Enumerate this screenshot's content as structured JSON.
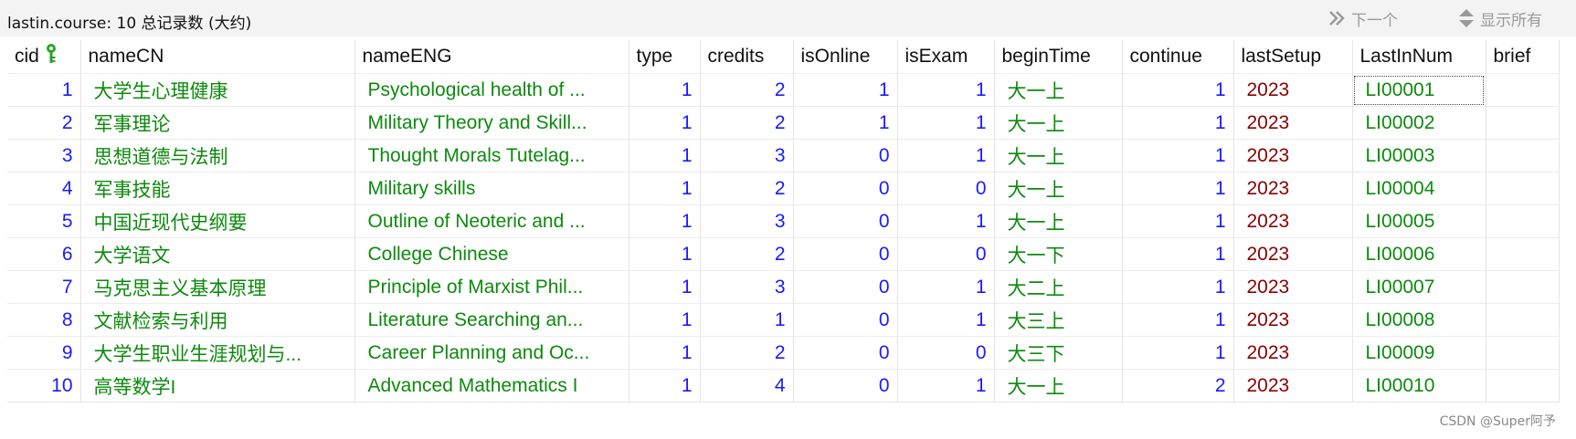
{
  "toolbar": {
    "record_label": "lastin.course: 10 总记录数 (大约)",
    "next_label": "下一个",
    "show_all_label": "显示所有"
  },
  "table": {
    "columns": [
      "cid",
      "nameCN",
      "nameENG",
      "type",
      "credits",
      "isOnline",
      "isExam",
      "beginTime",
      "continue",
      "lastSetup",
      "LastInNum",
      "brief"
    ],
    "rows": [
      [
        "1",
        "大学生心理健康",
        "Psychological health of ...",
        "1",
        "2",
        "1",
        "1",
        "大一上",
        "1",
        "2023",
        "LI00001",
        ""
      ],
      [
        "2",
        "军事理论",
        "Military Theory and Skill...",
        "1",
        "2",
        "1",
        "1",
        "大一上",
        "1",
        "2023",
        "LI00002",
        ""
      ],
      [
        "3",
        "思想道德与法制",
        "Thought Morals Tutelag...",
        "1",
        "3",
        "0",
        "1",
        "大一上",
        "1",
        "2023",
        "LI00003",
        ""
      ],
      [
        "4",
        "军事技能",
        "Military skills",
        "1",
        "2",
        "0",
        "0",
        "大一上",
        "1",
        "2023",
        "LI00004",
        ""
      ],
      [
        "5",
        "中国近现代史纲要",
        "Outline of Neoteric and ...",
        "1",
        "3",
        "0",
        "1",
        "大一上",
        "1",
        "2023",
        "LI00005",
        ""
      ],
      [
        "6",
        "大学语文",
        "College Chinese",
        "1",
        "2",
        "0",
        "0",
        "大一下",
        "1",
        "2023",
        "LI00006",
        ""
      ],
      [
        "7",
        "马克思主义基本原理",
        "Principle of Marxist Phil...",
        "1",
        "3",
        "0",
        "1",
        "大二上",
        "1",
        "2023",
        "LI00007",
        ""
      ],
      [
        "8",
        "文献检索与利用",
        "Literature Searching an...",
        "1",
        "1",
        "0",
        "1",
        "大三上",
        "1",
        "2023",
        "LI00008",
        ""
      ],
      [
        "9",
        "大学生职业生涯规划与...",
        "Career Planning and Oc...",
        "1",
        "2",
        "0",
        "0",
        "大三下",
        "1",
        "2023",
        "LI00009",
        ""
      ],
      [
        "10",
        "高等数学I",
        "Advanced Mathematics I",
        "1",
        "4",
        "0",
        "1",
        "大一上",
        "2",
        "2023",
        "LI00010",
        ""
      ]
    ],
    "selected_cell": {
      "row": 0,
      "column": "LastInNum"
    }
  },
  "icons": {
    "primary_key": "key-icon",
    "next": "double-chevron-right-icon",
    "show_all": "up-down-arrows-icon"
  },
  "colors": {
    "number": "#1a1aff",
    "string": "#0d8a0d",
    "year": "#8b0000",
    "primary_key_icon": "#2aa52a"
  },
  "watermark": "CSDN @Super阿予"
}
